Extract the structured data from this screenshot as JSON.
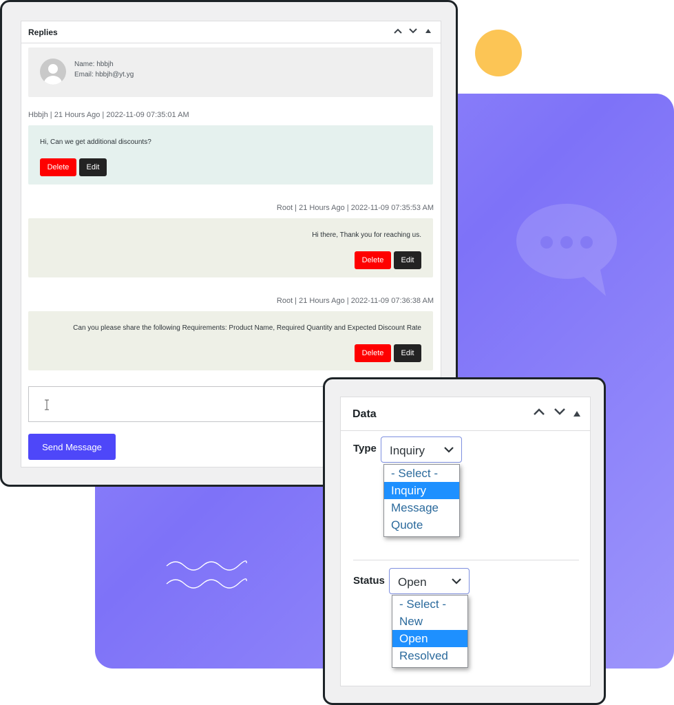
{
  "replies_panel": {
    "title": "Replies",
    "user": {
      "name": "Name: hbbjh",
      "email": "Email: hbbjh@yt.yg"
    },
    "messages": [
      {
        "meta": "Hbbjh | 21 Hours Ago | 2022-11-09 07:35:01 AM",
        "text": "Hi, Can we get additional discounts?",
        "delete_label": "Delete",
        "edit_label": "Edit"
      },
      {
        "meta": "Root | 21 Hours Ago | 2022-11-09 07:35:53 AM",
        "text": "Hi there, Thank you for reaching us.",
        "delete_label": "Delete",
        "edit_label": "Edit"
      },
      {
        "meta": "Root | 21 Hours Ago | 2022-11-09 07:36:38 AM",
        "text": "Can you please share the following Requirements: Product Name, Required Quantity and Expected Discount Rate",
        "delete_label": "Delete",
        "edit_label": "Edit"
      }
    ],
    "send_label": "Send Message"
  },
  "data_panel": {
    "title": "Data",
    "type": {
      "label": "Type",
      "selected": "Inquiry",
      "options": [
        "- Select -",
        "Inquiry",
        "Message",
        "Quote"
      ]
    },
    "status": {
      "label": "Status",
      "selected": "Open",
      "options": [
        "- Select -",
        "New",
        "Open",
        "Resolved"
      ]
    }
  },
  "colors": {
    "accent": "#4e47f9",
    "delete": "#fe0000",
    "edit": "#232323",
    "highlight": "#1e90ff",
    "background_panel": "#8a7ff9",
    "decor_circle": "#fcc555"
  },
  "icons": [
    "chevron-up-icon",
    "chevron-down-icon",
    "collapse-triangle-icon",
    "avatar-placeholder-icon",
    "chat-bubble-icon",
    "text-cursor-icon"
  ]
}
